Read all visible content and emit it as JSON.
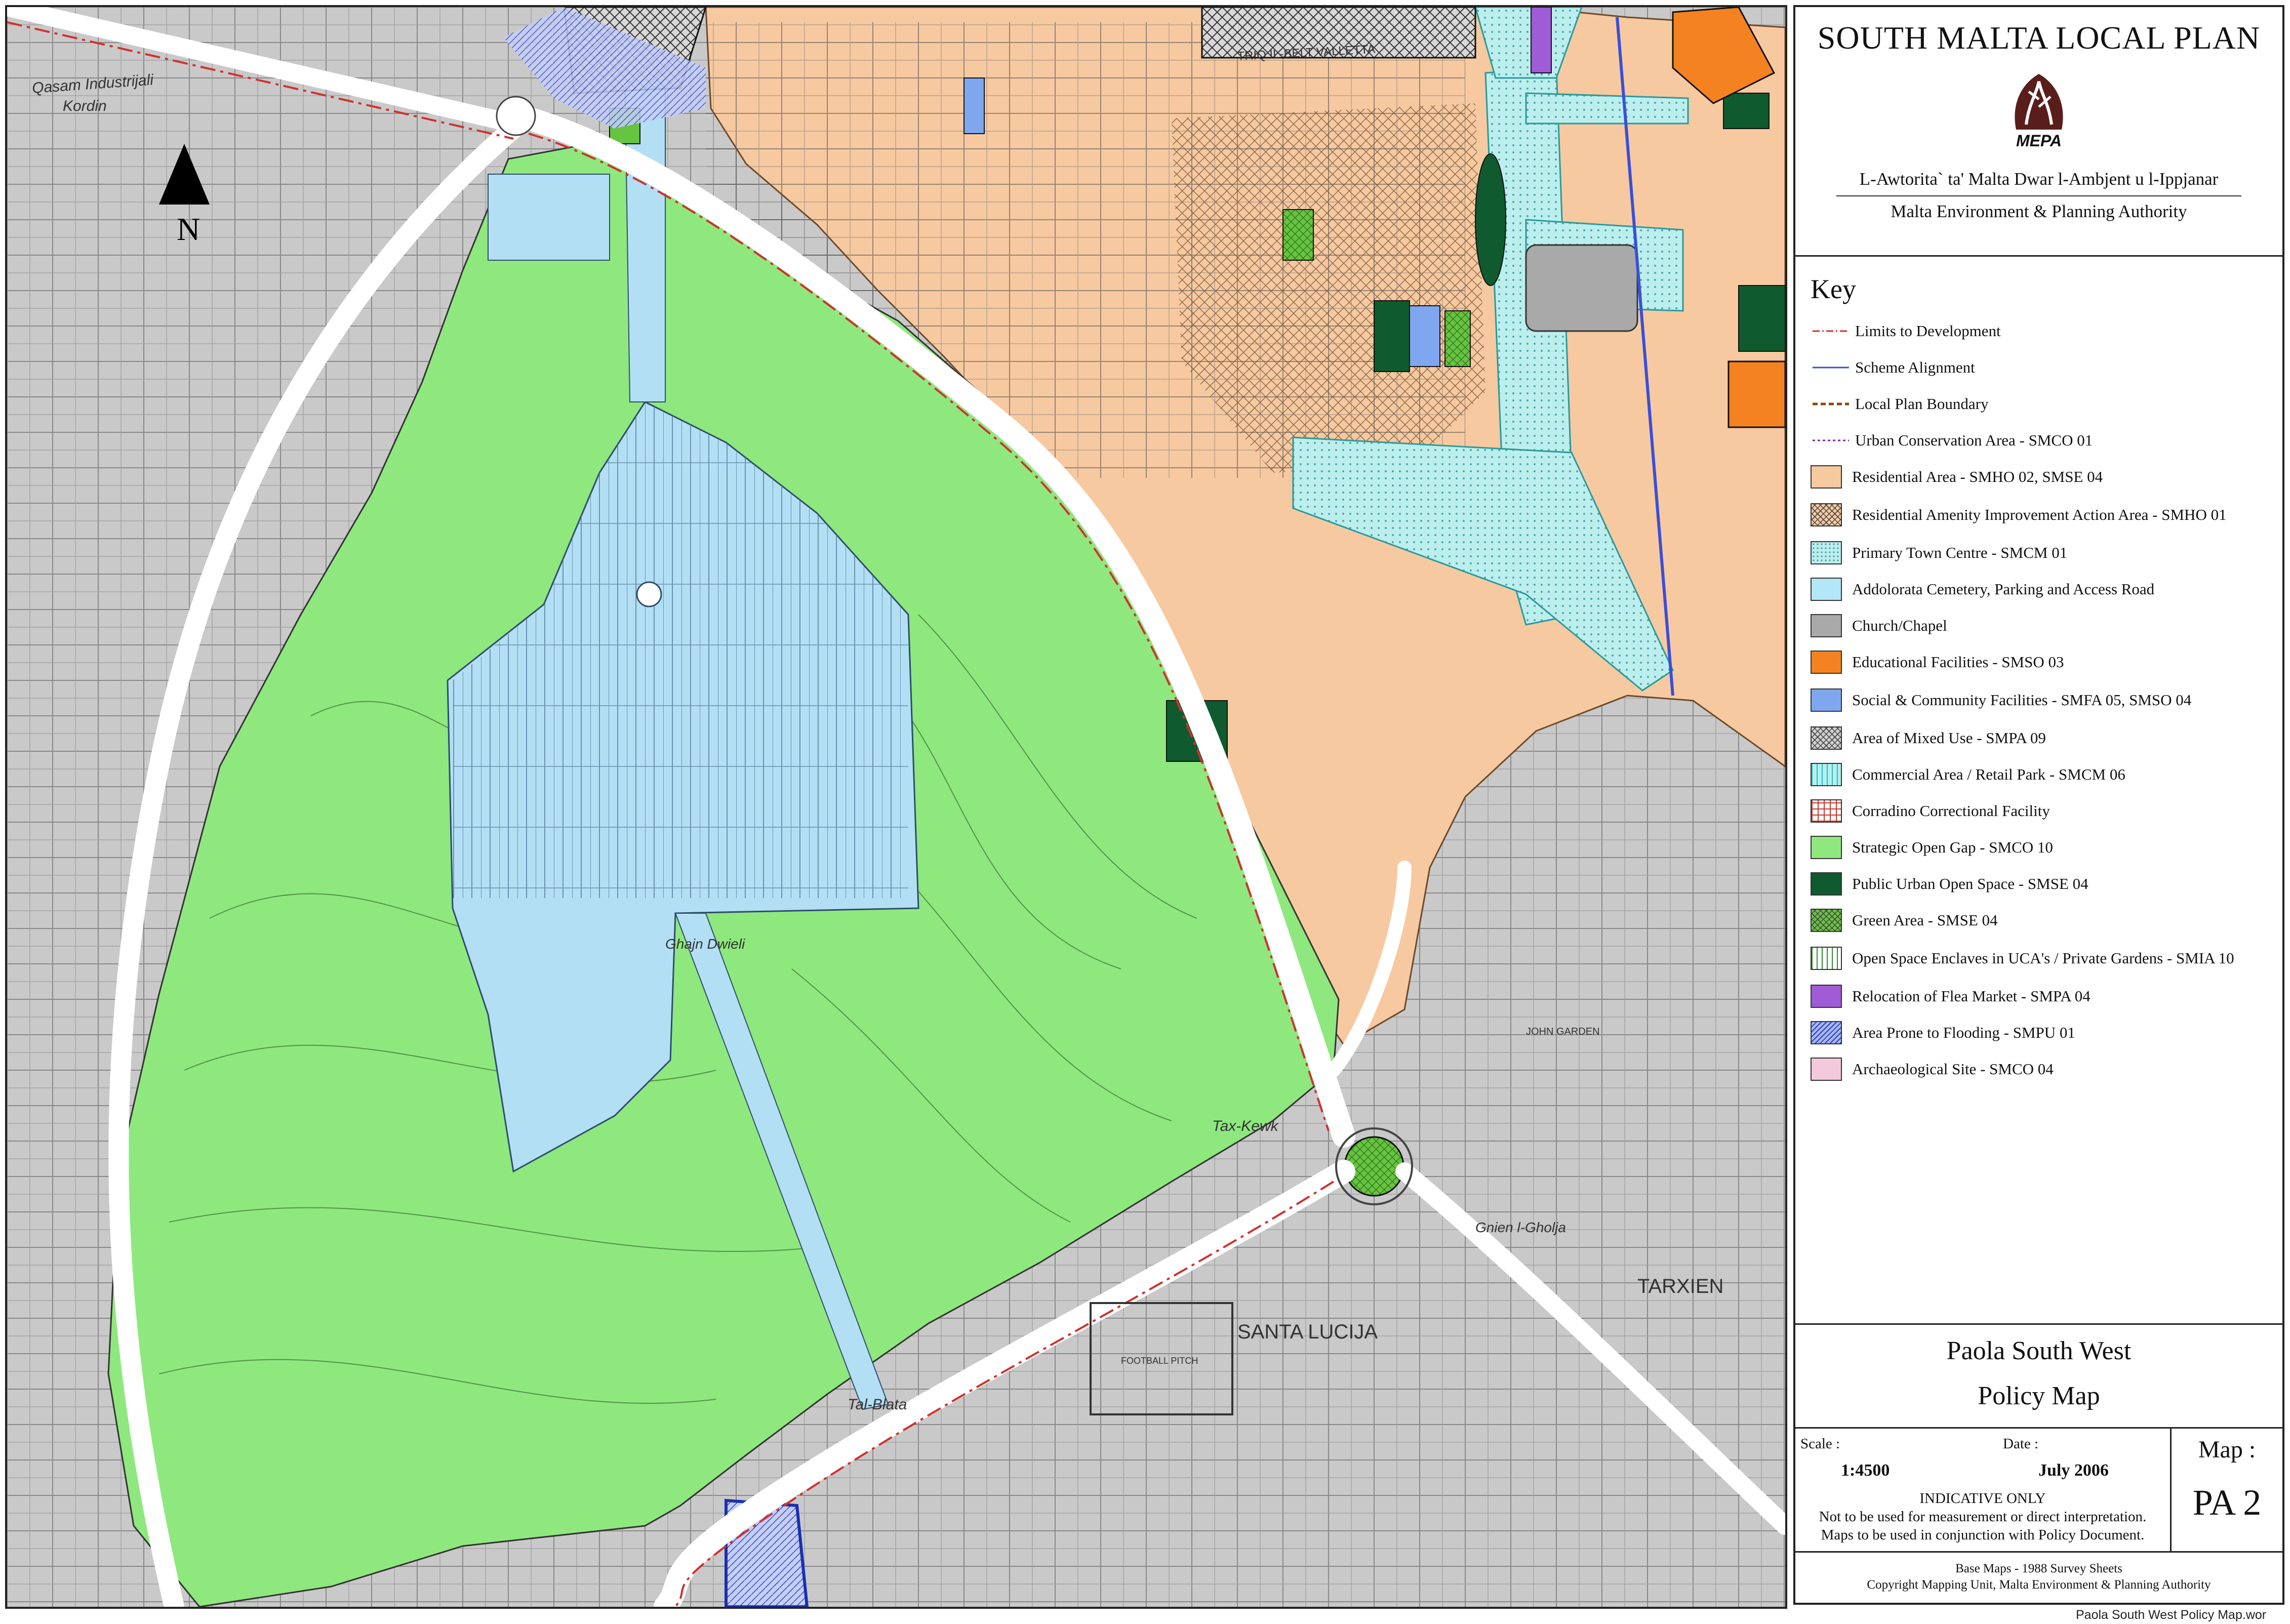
{
  "title_block": {
    "plan_title": "SOUTH MALTA LOCAL PLAN",
    "logo_text": "MEPA",
    "authority_mt": "L-Awtorita` ta' Malta Dwar l-Ambjent u l-Ippjanar",
    "authority_en": "Malta Environment & Planning Authority"
  },
  "key": {
    "title": "Key",
    "items": [
      {
        "label": "Limits to Development",
        "symbol": "dash-dot-line",
        "color": "#d0312d"
      },
      {
        "label": "Scheme Alignment",
        "symbol": "solid-line",
        "color": "#3a4fd8"
      },
      {
        "label": "Local Plan Boundary",
        "symbol": "dashed-line",
        "color": "#8b4513"
      },
      {
        "label": "Urban Conservation Area - SMCO 01",
        "symbol": "dotted-line",
        "color": "#7a2a8a"
      },
      {
        "label": "Residential Area - SMHO 02, SMSE 04",
        "symbol": "fill",
        "color": "#f7c9a0"
      },
      {
        "label": "Residential Amenity Improvement Action Area - SMHO 01",
        "symbol": "crosshatch",
        "color": "#f7c9a0"
      },
      {
        "label": "Primary Town Centre - SMCM 01",
        "symbol": "dots",
        "color": "#bdeeee"
      },
      {
        "label": "Addolorata Cemetery, Parking and Access Road",
        "symbol": "fill",
        "color": "#b3e6f7"
      },
      {
        "label": "Church/Chapel",
        "symbol": "fill",
        "color": "#a9a9a9"
      },
      {
        "label": "Educational Facilities - SMSO 03",
        "symbol": "fill",
        "color": "#f58220"
      },
      {
        "label": "Social & Community Facilities - SMFA 05, SMSO 04",
        "symbol": "fill",
        "color": "#7fa7f0"
      },
      {
        "label": "Area of Mixed Use - SMPA 09",
        "symbol": "crosshatch",
        "color": "#cfcfcf"
      },
      {
        "label": "Commercial Area / Retail Park - SMCM 06",
        "symbol": "vlines",
        "color": "#b3f0f0"
      },
      {
        "label": "Corradino Correctional Facility",
        "symbol": "grid",
        "color": "#ffffff",
        "line_color": "#c0392b"
      },
      {
        "label": "Strategic Open Gap - SMCO 10",
        "symbol": "fill",
        "color": "#8ee87e"
      },
      {
        "label": "Public Urban Open Space - SMSE 04",
        "symbol": "fill",
        "color": "#0f5a2e"
      },
      {
        "label": "Green Area - SMSE 04",
        "symbol": "crosshatch",
        "color": "#66c43f"
      },
      {
        "label": "Open Space Enclaves in UCA's / Private Gardens - SMIA 10",
        "symbol": "vlines",
        "color": "#ffffff",
        "line_color": "#2e8b2e"
      },
      {
        "label": "Relocation of Flea Market - SMPA 04",
        "symbol": "fill",
        "color": "#a05bd6"
      },
      {
        "label": "Area Prone to Flooding - SMPU 01",
        "symbol": "diag",
        "color": "#a9b8f0",
        "line_color": "#2c3ecf"
      },
      {
        "label": "Archaeological Site - SMCO 04",
        "symbol": "fill",
        "color": "#f3c9dc"
      }
    ]
  },
  "map_name": {
    "line1": "Paola South West",
    "line2": "Policy Map"
  },
  "info": {
    "scale_caption": "Scale :",
    "scale_value": "1:4500",
    "date_caption": "Date :",
    "date_value": "July 2006",
    "indicative_1": "INDICATIVE ONLY",
    "indicative_2": "Not to be used for measurement or direct interpretation.",
    "indicative_3": "Maps to be used in conjunction with Policy Document.",
    "map_caption": "Map :",
    "map_number": "PA 2"
  },
  "credits": {
    "line1": "Base Maps - 1988 Survey Sheets",
    "line2": "Copyright Mapping Unit, Malta Environment & Planning Authority"
  },
  "file_name": "Paola South West Policy Map.wor",
  "map_labels": {
    "north": "N",
    "triq_il_belt_valletta": "TRIQ IL-BELT VALLETTA",
    "qasam_industrijali": "Qasam Industrijali",
    "kordin": "Kordin",
    "santa_lucija": "SANTA LUCIJA",
    "tarxien": "TARXIEN",
    "tal_blata": "Tal-Blata",
    "ghajn_dwieli": "Ghajn Dwieli",
    "tax_kewk": "Tax-Kewk",
    "gnien_l_gholja": "Gnien l-Gholja",
    "john_garden": "JOHN GARDEN",
    "football_pitch": "FOOTBALL PITCH"
  },
  "colors": {
    "strategic_open_gap": "#8ee87e",
    "cemetery": "#b3dff5",
    "residential": "#f7c9a0",
    "built_grey": "#c9c9c9",
    "primary_town_centre": "#bdeeee",
    "public_open_space": "#0f5a2e",
    "education": "#f58220",
    "social": "#7fa7f0",
    "flea_market": "#a05bd6"
  }
}
